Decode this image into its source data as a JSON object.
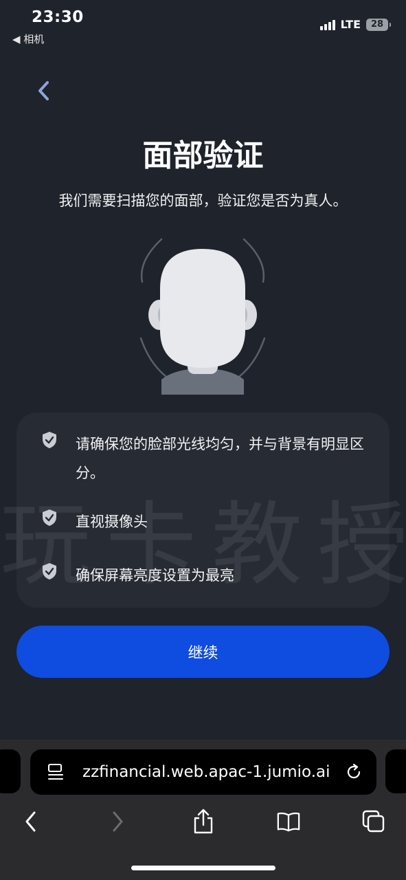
{
  "status_bar": {
    "time": "23:30",
    "back_app": "◀ 相机",
    "network": "LTE",
    "battery": "28"
  },
  "page": {
    "title": "面部验证",
    "subtitle": "我们需要扫描您的面部，验证您是否为真人。",
    "tips": [
      {
        "text": "请确保您的脸部光线均匀，并与背景有明显区分。"
      },
      {
        "text": "直视摄像头"
      },
      {
        "text": "确保屏幕亮度设置为最亮"
      }
    ],
    "watermark": "玩卡教授",
    "continue_label": "继续"
  },
  "browser": {
    "url": "zzfinancial.web.apac-1.jumio.ai"
  },
  "icons": {
    "back": "chevron-left-icon",
    "tip": "shield-check-icon",
    "page_menu": "page-menu-icon",
    "reload": "reload-icon",
    "nav_back": "chevron-left-icon",
    "nav_forward": "chevron-right-icon",
    "share": "share-icon",
    "bookmarks": "book-icon",
    "tabs": "tabs-icon"
  },
  "colors": {
    "background": "#1e232c",
    "primary_button": "#0f4ce0",
    "accent": "#8fa3d6"
  }
}
